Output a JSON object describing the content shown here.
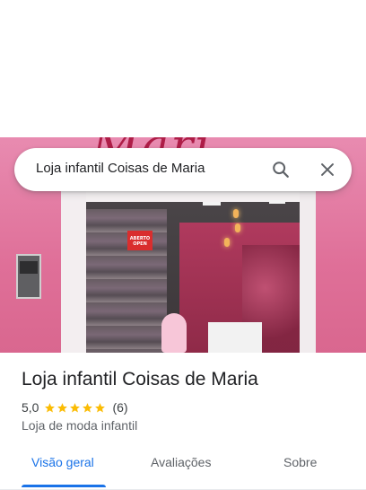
{
  "search": {
    "query": "Loja infantil Coisas de Maria",
    "search_icon": "search-icon",
    "close_icon": "close-icon"
  },
  "hero": {
    "open_sign_line1": "ABERTO",
    "open_sign_line2": "OPEN"
  },
  "place": {
    "title": "Loja infantil Coisas de Maria",
    "rating": "5,0",
    "stars": 5,
    "review_count": "(6)",
    "category": "Loja de moda infantil"
  },
  "tabs": [
    {
      "label": "Visão geral",
      "active": true
    },
    {
      "label": "Avaliações",
      "active": false
    },
    {
      "label": "Sobre",
      "active": false
    }
  ],
  "colors": {
    "accent": "#1a73e8",
    "star": "#fbbc04",
    "text_primary": "#202124",
    "text_secondary": "#5f6368"
  }
}
